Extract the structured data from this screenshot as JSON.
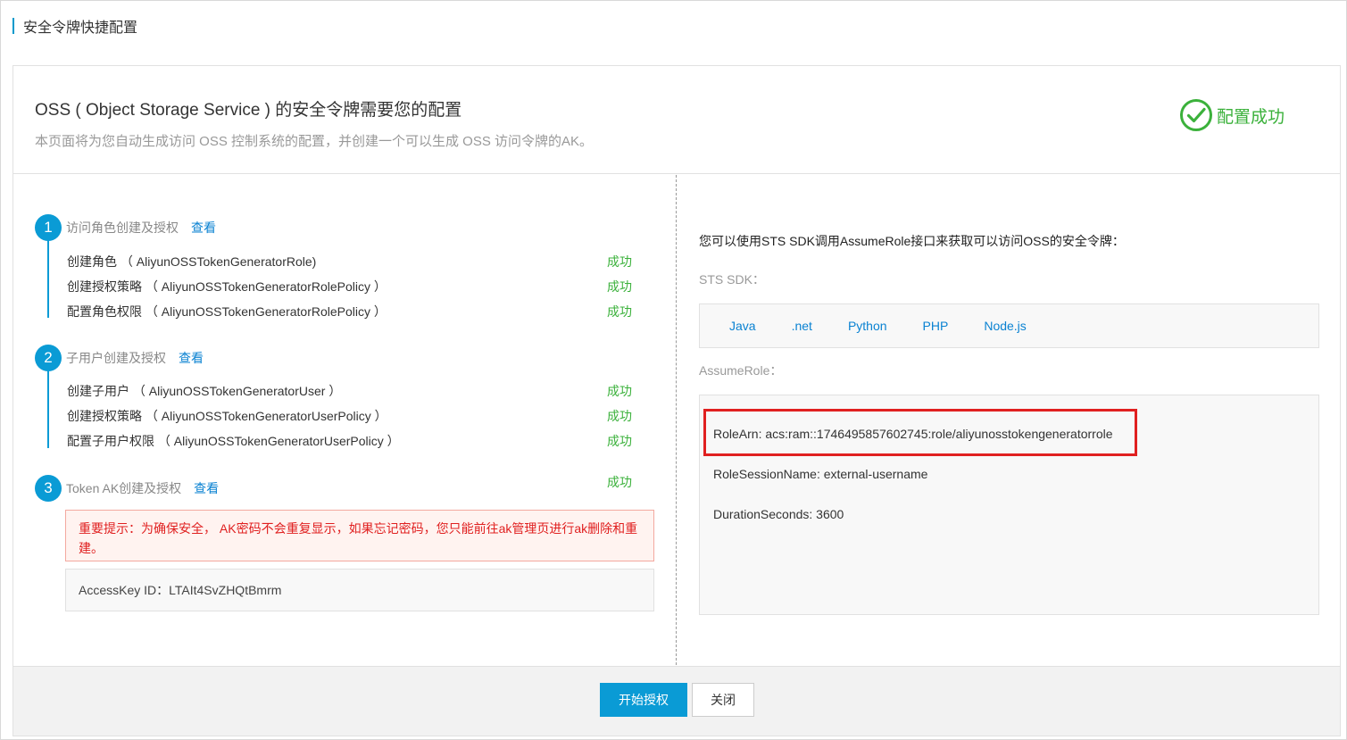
{
  "page": {
    "title": "安全令牌快捷配置"
  },
  "header": {
    "title": "OSS ( Object Storage Service ) 的安全令牌需要您的配置",
    "subtitle": "本页面将为您自动生成访问 OSS 控制系统的配置，并创建一个可以生成 OSS 访问令牌的AK。",
    "status_label": "配置成功",
    "status_color": "#3bb13b",
    "status_icon": "check-circle-icon"
  },
  "steps": [
    {
      "number": "1",
      "name": "访问角色创建及授权",
      "link": "查看",
      "items": [
        {
          "label": "创建角色 （ AliyunOSSTokenGeneratorRole)",
          "status": "成功"
        },
        {
          "label": "创建授权策略 （ AliyunOSSTokenGeneratorRolePolicy ）",
          "status": "成功"
        },
        {
          "label": "配置角色权限 （ AliyunOSSTokenGeneratorRolePolicy ）",
          "status": "成功"
        }
      ]
    },
    {
      "number": "2",
      "name": "子用户创建及授权",
      "link": "查看",
      "items": [
        {
          "label": "创建子用户 （ AliyunOSSTokenGeneratorUser ）",
          "status": "成功"
        },
        {
          "label": "创建授权策略 （ AliyunOSSTokenGeneratorUserPolicy ）",
          "status": "成功"
        },
        {
          "label": "配置子用户权限 （ AliyunOSSTokenGeneratorUserPolicy ）",
          "status": "成功"
        }
      ]
    },
    {
      "number": "3",
      "name": "Token AK创建及授权",
      "link": "查看",
      "status": "成功"
    }
  ],
  "warning": "重要提示：为确保安全， AK密码不会重复显示，如果忘记密码，您只能前往ak管理页进行ak删除和重建。",
  "access_key": "AccessKey ID：LTAIt4SvZHQtBmrm",
  "right": {
    "intro": "您可以使用STS SDK调用AssumeRole接口来获取可以访问OSS的安全令牌：",
    "sdk_label": "STS SDK：",
    "sdks": [
      "Java",
      ".net",
      "Python",
      "PHP",
      "Node.js"
    ],
    "assume_label": "AssumeRole：",
    "params": [
      "RoleArn: acs:ram::1746495857602745:role/aliyunosstokengeneratorrole",
      "RoleSessionName: external-username",
      "DurationSeconds: 3600"
    ]
  },
  "footer": {
    "primary_label": "开始授权",
    "secondary_label": "关闭"
  },
  "colors": {
    "accent": "#0a9bd5",
    "link": "#0a82d2",
    "success": "#3bb13b",
    "danger": "#e02020"
  }
}
